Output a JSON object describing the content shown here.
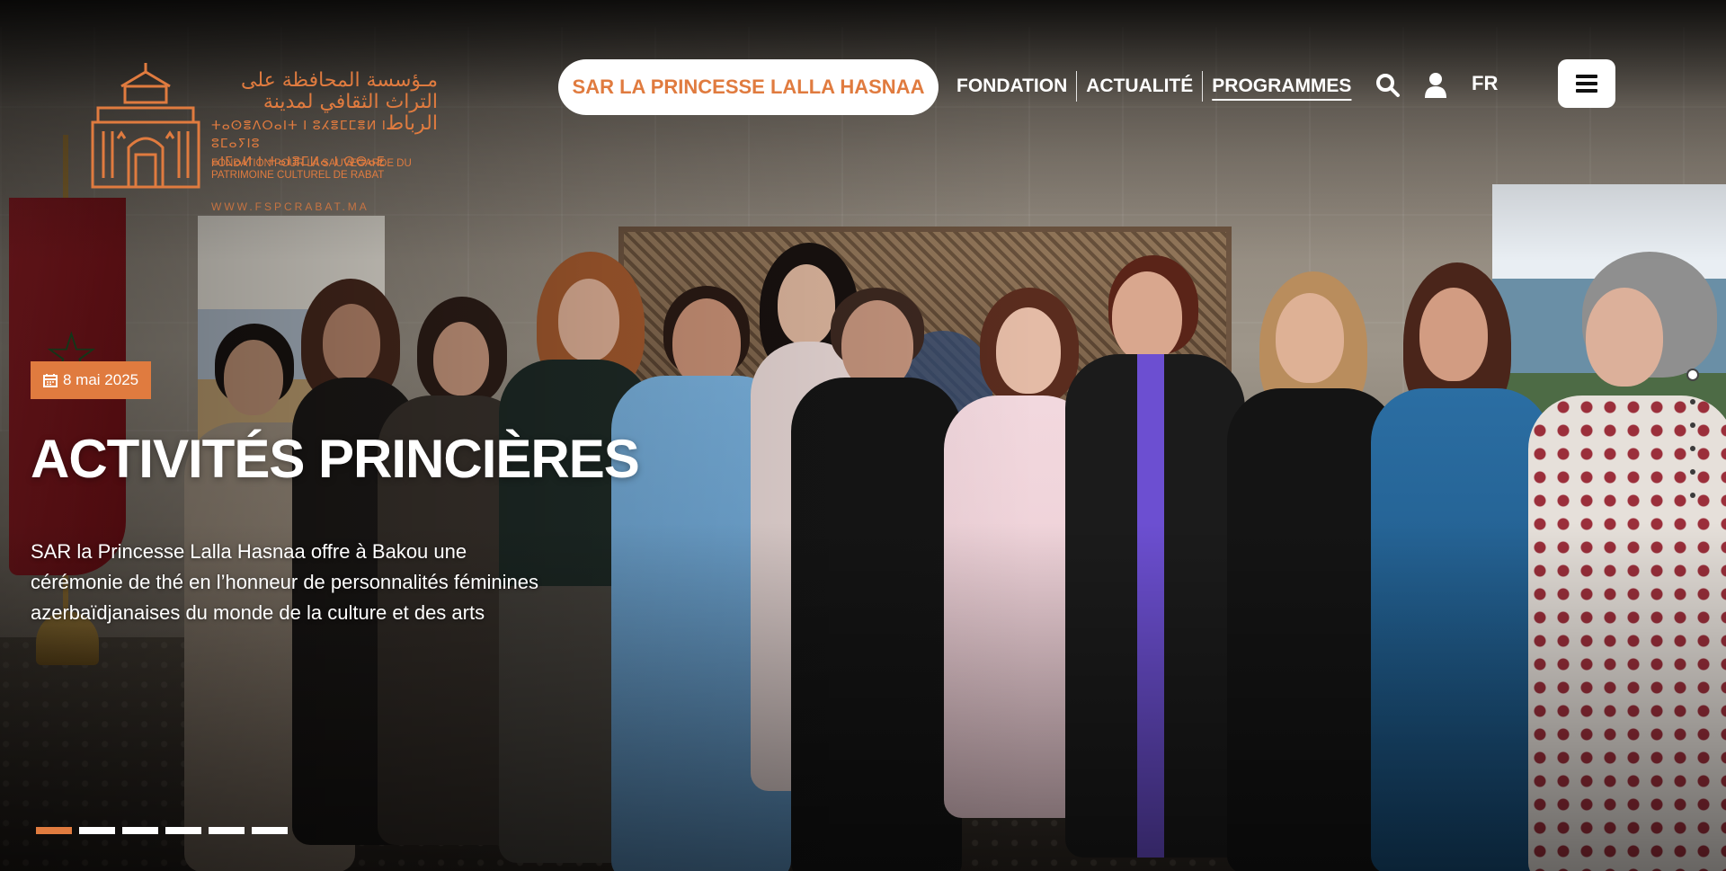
{
  "logo": {
    "arabic_line1": "مـؤسسة المحافظة على",
    "arabic_line2": "التراث الثقافي لمدينة الرباط",
    "tifinagh_line1": "ⵜⴰⵙⴻⴷⵔⴰⵏⵜ ⵏ ⵓⵃⴻⵎⵎⴻⵍ ⵏ ⵓⵎⴰⵢⵏⵓ",
    "tifinagh_line2": "ⴰⵏⵎⴰⵍ ⵏ ⵜⴰⵏⴻⵎⵍⴰ ⵏ ⵕⴱⴰⵟ",
    "french": "FONDATION POUR LA SAUVEGARDE DU PATRIMOINE CULTUREL DE RABAT",
    "url": "WWW.FSPCRABAT.MA",
    "color": "#e07b3f"
  },
  "nav": {
    "pill_label": "SAR LA PRINCESSE LALLA HASNAA",
    "links": [
      {
        "label": "FONDATION",
        "active": false
      },
      {
        "label": "ACTUALITÉ",
        "active": false
      },
      {
        "label": "PROGRAMMES",
        "active": true
      }
    ],
    "search_icon": "search-icon",
    "user_icon": "user-icon",
    "language": "FR",
    "menu_icon": "hamburger-menu-icon"
  },
  "hero": {
    "date": "8 mai 2025",
    "date_icon": "calendar-icon",
    "title": "ACTIVITÉS PRINCIÈRES",
    "description": "SAR la Princesse Lalla Hasnaa offre à Bakou une cérémonie de thé en l’honneur de personnalités féminines azerbaïdjanaises du monde de la culture et des arts",
    "accent_color": "#e07b3f"
  },
  "slider": {
    "total_slides": 6,
    "active_index": 0,
    "side_dots": 6,
    "side_active_index": 0
  }
}
